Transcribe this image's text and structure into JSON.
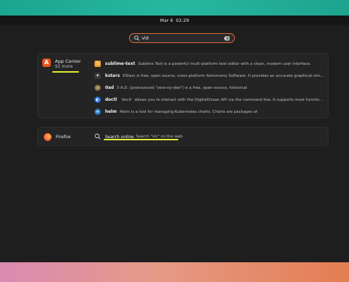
{
  "topbar": {
    "date": "Mar 6",
    "time": "02:29"
  },
  "search": {
    "value": "vld",
    "placeholder": ""
  },
  "app_center": {
    "name": "App Center",
    "more": "92 more",
    "results": [
      {
        "name": "sublime-text",
        "desc": "Sublime Text is a powerful multi-platform text editor with a clean, modern user interface.",
        "icon": "sublime-text-icon",
        "color": "#f0a030"
      },
      {
        "name": "kstars",
        "desc": "KStars is free, open source, cross-platform Astronomy Software. It provides an accurate graphical simulatio...",
        "icon": "kstars-icon",
        "color": "#3a3a3a"
      },
      {
        "name": "0ad",
        "desc": "0 A.D. (pronounced \"zero-ey-dee\") is a free, open-source, historical",
        "icon": "0ad-icon",
        "color": "#7a6a3a"
      },
      {
        "name": "doctl",
        "desc": "`doctl` allows you to interact with the DigitalOcean API via the command line. It supports most functionality...",
        "icon": "doctl-icon",
        "color": "#1f6fe0"
      },
      {
        "name": "helm",
        "desc": "Helm is a tool for managing Kubernetes charts. Charts are packages of",
        "icon": "helm-icon",
        "color": "#2a77c9"
      }
    ]
  },
  "firefox": {
    "name": "Firefox",
    "search_label": "Search online",
    "search_desc": "Search \"vlc\" on the web"
  },
  "colors": {
    "accent": "#e95420",
    "highlight": "#e6f23a"
  }
}
